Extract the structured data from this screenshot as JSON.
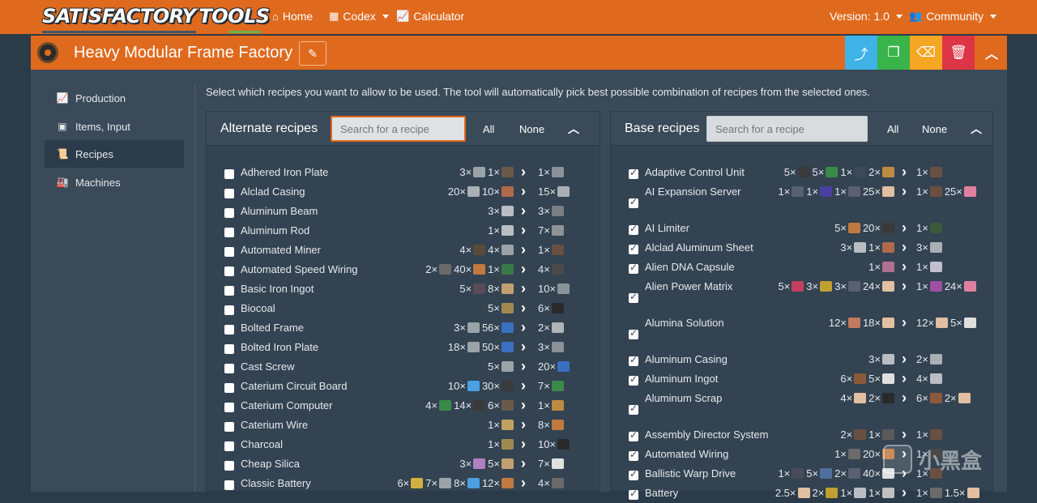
{
  "navbar": {
    "logo_word1": "SATISFACTORY",
    "logo_word2": "TOOLS",
    "home": "Home",
    "codex": "Codex",
    "calculator": "Calculator",
    "version": "Version: 1.0",
    "community": "Community"
  },
  "factory": {
    "title": "Heavy Modular Frame Factory"
  },
  "colors": {
    "accent": "#df6a1e",
    "share": "#3fb3e6",
    "clone": "#38b44a",
    "clear": "#f5a623",
    "delete": "#dc3545"
  },
  "sidebar": {
    "items": [
      {
        "label": "Production",
        "icon": "chart-line-icon"
      },
      {
        "label": "Items, Input",
        "icon": "cubes-icon"
      },
      {
        "label": "Recipes",
        "icon": "scroll-icon"
      },
      {
        "label": "Machines",
        "icon": "industry-icon"
      }
    ]
  },
  "instructions": "Select which recipes you want to allow to be used. The tool will automatically pick best possible combination of recipes from the selected ones.",
  "alternate": {
    "title": "Alternate recipes",
    "search_placeholder": "Search for a recipe",
    "all": "All",
    "none": "None",
    "rows": [
      {
        "name": "Adhered Iron Plate",
        "checked": false,
        "inputs": [
          {
            "q": "3×",
            "c": "#9aa3a8"
          },
          {
            "q": "1×",
            "c": "#6a5a4a"
          }
        ],
        "outputs": [
          {
            "q": "1×",
            "c": "#8a939a"
          }
        ]
      },
      {
        "name": "Alclad Casing",
        "checked": false,
        "inputs": [
          {
            "q": "20×",
            "c": "#a9b0b5"
          },
          {
            "q": "10×",
            "c": "#b06a4a"
          }
        ],
        "outputs": [
          {
            "q": "15×",
            "c": "#a9b0b5"
          }
        ]
      },
      {
        "name": "Aluminum Beam",
        "checked": false,
        "inputs": [
          {
            "q": "3×",
            "c": "#b8bec2"
          }
        ],
        "outputs": [
          {
            "q": "3×",
            "c": "#7a7f84"
          }
        ]
      },
      {
        "name": "Aluminum Rod",
        "checked": false,
        "inputs": [
          {
            "q": "1×",
            "c": "#b8bec2"
          }
        ],
        "outputs": [
          {
            "q": "7×",
            "c": "#8e9398"
          }
        ]
      },
      {
        "name": "Automated Miner",
        "checked": false,
        "inputs": [
          {
            "q": "4×",
            "c": "#5a4a3a"
          },
          {
            "q": "4×",
            "c": "#9aa3a8"
          }
        ],
        "outputs": [
          {
            "q": "1×",
            "c": "#6a5040"
          }
        ]
      },
      {
        "name": "Automated Speed Wiring",
        "checked": false,
        "inputs": [
          {
            "q": "2×",
            "c": "#6a6a6a"
          },
          {
            "q": "40×",
            "c": "#c07a40"
          },
          {
            "q": "1×",
            "c": "#3a7a4a"
          }
        ],
        "outputs": [
          {
            "q": "4×",
            "c": "#4a4a4a"
          }
        ]
      },
      {
        "name": "Basic Iron Ingot",
        "checked": false,
        "inputs": [
          {
            "q": "5×",
            "c": "#5a4a5a"
          },
          {
            "q": "8×",
            "c": "#c0a070"
          }
        ],
        "outputs": [
          {
            "q": "10×",
            "c": "#8a939a"
          }
        ]
      },
      {
        "name": "Biocoal",
        "checked": false,
        "inputs": [
          {
            "q": "5×",
            "c": "#a08a50"
          }
        ],
        "outputs": [
          {
            "q": "6×",
            "c": "#2a2a2a"
          }
        ]
      },
      {
        "name": "Bolted Frame",
        "checked": false,
        "inputs": [
          {
            "q": "3×",
            "c": "#9aa3a8"
          },
          {
            "q": "56×",
            "c": "#3a70c0"
          }
        ],
        "outputs": [
          {
            "q": "2×",
            "c": "#b0b5b8"
          }
        ]
      },
      {
        "name": "Bolted Iron Plate",
        "checked": false,
        "inputs": [
          {
            "q": "18×",
            "c": "#9aa3a8"
          },
          {
            "q": "50×",
            "c": "#3a70c0"
          }
        ],
        "outputs": [
          {
            "q": "3×",
            "c": "#8a939a"
          }
        ]
      },
      {
        "name": "Cast Screw",
        "checked": false,
        "inputs": [
          {
            "q": "5×",
            "c": "#9aa3a8"
          }
        ],
        "outputs": [
          {
            "q": "20×",
            "c": "#3a70c0"
          }
        ]
      },
      {
        "name": "Caterium Circuit Board",
        "checked": false,
        "inputs": [
          {
            "q": "10×",
            "c": "#4aa0e0"
          },
          {
            "q": "30×",
            "c": "#3a3a3a"
          }
        ],
        "outputs": [
          {
            "q": "7×",
            "c": "#3a8a4a"
          }
        ]
      },
      {
        "name": "Caterium Computer",
        "checked": false,
        "inputs": [
          {
            "q": "4×",
            "c": "#3a8a4a"
          },
          {
            "q": "14×",
            "c": "#3a3a3a"
          },
          {
            "q": "6×",
            "c": "#6a5a4a"
          }
        ],
        "outputs": [
          {
            "q": "1×",
            "c": "#c08a40"
          }
        ]
      },
      {
        "name": "Caterium Wire",
        "checked": false,
        "inputs": [
          {
            "q": "1×",
            "c": "#c0a060"
          }
        ],
        "outputs": [
          {
            "q": "8×",
            "c": "#c07a40"
          }
        ]
      },
      {
        "name": "Charcoal",
        "checked": false,
        "inputs": [
          {
            "q": "1×",
            "c": "#a08a50"
          }
        ],
        "outputs": [
          {
            "q": "10×",
            "c": "#2a2a2a"
          }
        ]
      },
      {
        "name": "Cheap Silica",
        "checked": false,
        "inputs": [
          {
            "q": "3×",
            "c": "#b080c0"
          },
          {
            "q": "5×",
            "c": "#c0a070"
          }
        ],
        "outputs": [
          {
            "q": "7×",
            "c": "#e0e0e0"
          }
        ]
      },
      {
        "name": "Classic Battery",
        "checked": false,
        "inputs": [
          {
            "q": "6×",
            "c": "#d0b040"
          },
          {
            "q": "7×",
            "c": "#9aa3a8"
          },
          {
            "q": "8×",
            "c": "#4aa0e0"
          },
          {
            "q": "12×",
            "c": "#c07a40"
          }
        ],
        "outputs": [
          {
            "q": "4×",
            "c": "#6a6a6a"
          }
        ]
      }
    ]
  },
  "base": {
    "title": "Base recipes",
    "search_placeholder": "Search for a recipe",
    "all": "All",
    "none": "None",
    "rows": [
      {
        "name": "Adaptive Control Unit",
        "checked": true,
        "inputs": [
          {
            "q": "5×",
            "c": "#3a3a3a"
          },
          {
            "q": "5×",
            "c": "#3a8a4a"
          },
          {
            "q": "1×",
            "c": "#3a4a5a"
          },
          {
            "q": "2×",
            "c": "#c08a40"
          }
        ],
        "outputs": [
          {
            "q": "1×",
            "c": "#6a5040"
          }
        ],
        "tall": false
      },
      {
        "name": "AI Expansion Server",
        "checked": true,
        "inputs": [
          {
            "q": "1×",
            "c": "#5a6070"
          },
          {
            "q": "1×",
            "c": "#4a40a0"
          },
          {
            "q": "1×",
            "c": "#5a6070"
          },
          {
            "q": "25×",
            "c": "#e0c0a0"
          }
        ],
        "outputs": [
          {
            "q": "1×",
            "c": "#6a5040"
          },
          {
            "q": "25×",
            "c": "#e080a0"
          }
        ],
        "tall": true
      },
      {
        "name": "AI Limiter",
        "checked": true,
        "inputs": [
          {
            "q": "5×",
            "c": "#c07a40"
          },
          {
            "q": "20×",
            "c": "#3a3a3a"
          }
        ],
        "outputs": [
          {
            "q": "1×",
            "c": "#3a5a3a"
          }
        ],
        "tall": false
      },
      {
        "name": "Alclad Aluminum Sheet",
        "checked": true,
        "inputs": [
          {
            "q": "3×",
            "c": "#b8bec2"
          },
          {
            "q": "1×",
            "c": "#b06a4a"
          }
        ],
        "outputs": [
          {
            "q": "3×",
            "c": "#a9b0b5"
          }
        ],
        "tall": false
      },
      {
        "name": "Alien DNA Capsule",
        "checked": true,
        "inputs": [
          {
            "q": "1×",
            "c": "#b07090"
          }
        ],
        "outputs": [
          {
            "q": "1×",
            "c": "#c0c0d0"
          }
        ],
        "tall": false
      },
      {
        "name": "Alien Power Matrix",
        "checked": true,
        "inputs": [
          {
            "q": "5×",
            "c": "#c04060"
          },
          {
            "q": "3×",
            "c": "#c0a030"
          },
          {
            "q": "3×",
            "c": "#5a6070"
          },
          {
            "q": "24×",
            "c": "#e0c0a0"
          }
        ],
        "outputs": [
          {
            "q": "1×",
            "c": "#a050a0"
          },
          {
            "q": "24×",
            "c": "#e080a0"
          }
        ],
        "tall": true
      },
      {
        "name": "Alumina Solution",
        "checked": true,
        "inputs": [
          {
            "q": "12×",
            "c": "#c07a60"
          },
          {
            "q": "18×",
            "c": "#e0c0a0"
          }
        ],
        "outputs": [
          {
            "q": "12×",
            "c": "#e0c0a0"
          },
          {
            "q": "5×",
            "c": "#e0e0e0"
          }
        ],
        "tall": true
      },
      {
        "name": "Aluminum Casing",
        "checked": true,
        "inputs": [
          {
            "q": "3×",
            "c": "#b8bec2"
          }
        ],
        "outputs": [
          {
            "q": "2×",
            "c": "#a9b0b5"
          }
        ],
        "tall": false
      },
      {
        "name": "Aluminum Ingot",
        "checked": true,
        "inputs": [
          {
            "q": "6×",
            "c": "#8a5a3a"
          },
          {
            "q": "5×",
            "c": "#e0e0e0"
          }
        ],
        "outputs": [
          {
            "q": "4×",
            "c": "#b8bec2"
          }
        ],
        "tall": false
      },
      {
        "name": "Aluminum Scrap",
        "checked": true,
        "inputs": [
          {
            "q": "4×",
            "c": "#e0c0a0"
          },
          {
            "q": "2×",
            "c": "#2a2a2a"
          }
        ],
        "outputs": [
          {
            "q": "6×",
            "c": "#8a5a3a"
          },
          {
            "q": "2×",
            "c": "#e0c0a0"
          }
        ],
        "tall": true
      },
      {
        "name": "Assembly Director System",
        "checked": true,
        "inputs": [
          {
            "q": "2×",
            "c": "#6a5040"
          },
          {
            "q": "1×",
            "c": "#5a5a5a"
          }
        ],
        "outputs": [
          {
            "q": "1×",
            "c": "#6a5040"
          }
        ],
        "tall": false
      },
      {
        "name": "Automated Wiring",
        "checked": true,
        "inputs": [
          {
            "q": "1×",
            "c": "#6a6a6a"
          },
          {
            "q": "20×",
            "c": "#c07a40"
          }
        ],
        "outputs": [
          {
            "q": "1×",
            "c": "#4a4a4a"
          }
        ],
        "tall": false
      },
      {
        "name": "Ballistic Warp Drive",
        "checked": true,
        "inputs": [
          {
            "q": "1×",
            "c": "#4a4a5a"
          },
          {
            "q": "5×",
            "c": "#5070a0"
          },
          {
            "q": "2×",
            "c": "#5a6070"
          },
          {
            "q": "40×",
            "c": "#e0e0e0"
          }
        ],
        "outputs": [
          {
            "q": "1×",
            "c": "#6a5040"
          }
        ],
        "tall": false
      },
      {
        "name": "Battery",
        "checked": true,
        "inputs": [
          {
            "q": "2.5×",
            "c": "#e0c0a0"
          },
          {
            "q": "2×",
            "c": "#c0a030"
          },
          {
            "q": "1×",
            "c": "#b8bec2"
          },
          {
            "q": "1×",
            "c": "#c0c0c0"
          }
        ],
        "outputs": [
          {
            "q": "1×",
            "c": "#6a6a6a"
          },
          {
            "q": "1.5×",
            "c": "#e0c0a0"
          }
        ],
        "tall": false
      }
    ]
  },
  "watermark": "小黑盒"
}
